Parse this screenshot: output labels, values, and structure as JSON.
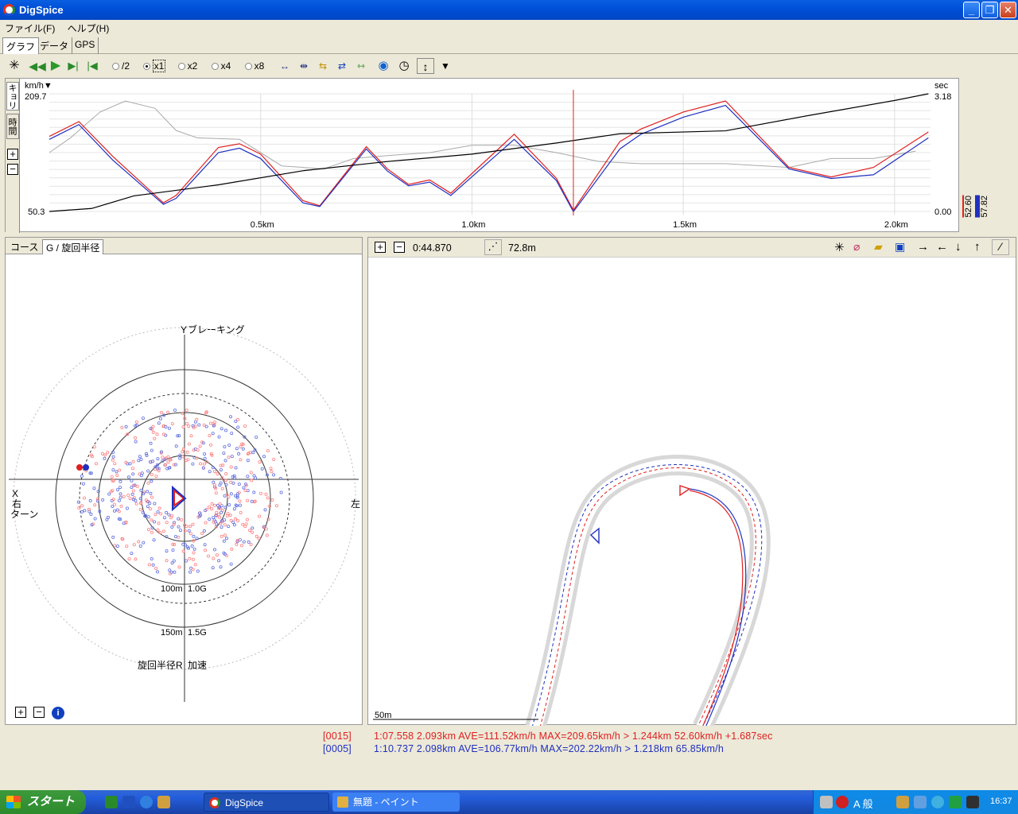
{
  "window": {
    "title": "DigSpice",
    "minimize": "_",
    "maximize": "❐",
    "close": "✕"
  },
  "menu": [
    "ファイル(F)",
    "ヘルプ(H)"
  ],
  "main_tabs": [
    "グラフ",
    "データ",
    "GPS"
  ],
  "toolbar": {
    "speeds": [
      "/2",
      "x1",
      "x2",
      "x4",
      "x8"
    ],
    "selected_speed": "x1"
  },
  "graph": {
    "vtabs": [
      "キョリ",
      "時間"
    ],
    "zoom_in": "⊞",
    "zoom_out": "⊟",
    "left_unit": "km/h▼",
    "left_max": "209.7",
    "left_min": "50.3",
    "right_unit": "sec",
    "right_max": "3.18",
    "right_min": "0.00",
    "x_ticks": [
      "0.5km",
      "1.0km",
      "1.5km",
      "2.0km"
    ],
    "side_values": [
      "52.60",
      "57.82"
    ]
  },
  "chart_data": {
    "type": "line",
    "xlabel": "",
    "ylabel": "km/h",
    "x_unit": "km",
    "ylim": [
      50.3,
      209.7
    ],
    "y2lim": [
      0.0,
      3.18
    ],
    "series": [
      {
        "color": "#e02020",
        "x": [
          0.0,
          0.07,
          0.15,
          0.27,
          0.3,
          0.4,
          0.45,
          0.5,
          0.6,
          0.64,
          0.75,
          0.8,
          0.85,
          0.9,
          0.95,
          1.1,
          1.2,
          1.24,
          1.35,
          1.4,
          1.5,
          1.6,
          1.75,
          1.85,
          1.95,
          2.08
        ],
        "y": [
          152,
          172,
          125,
          62,
          72,
          137,
          142,
          128,
          65,
          58,
          138,
          108,
          87,
          93,
          75,
          155,
          95,
          52,
          145,
          162,
          185,
          200,
          110,
          97,
          110,
          158
        ]
      },
      {
        "color": "#2030c0",
        "x": [
          0.0,
          0.07,
          0.15,
          0.27,
          0.3,
          0.4,
          0.45,
          0.5,
          0.6,
          0.64,
          0.75,
          0.8,
          0.85,
          0.9,
          0.95,
          1.1,
          1.2,
          1.24,
          1.35,
          1.4,
          1.5,
          1.6,
          1.75,
          1.85,
          1.95,
          2.08
        ],
        "y": [
          148,
          168,
          120,
          60,
          68,
          130,
          136,
          122,
          62,
          57,
          135,
          105,
          85,
          90,
          72,
          148,
          92,
          50,
          135,
          155,
          178,
          194,
          108,
          95,
          100,
          150
        ]
      },
      {
        "color": "#000000",
        "axis": "right",
        "x": [
          0.0,
          0.1,
          0.2,
          0.4,
          0.6,
          0.8,
          1.0,
          1.2,
          1.35,
          1.6,
          1.8,
          2.0,
          2.08
        ],
        "y": [
          0.0,
          0.08,
          0.42,
          0.72,
          1.1,
          1.35,
          1.55,
          1.85,
          2.1,
          2.18,
          2.6,
          3.0,
          3.18
        ]
      }
    ]
  },
  "gcircle": {
    "tabs": [
      "コース",
      "G / 旋回半径"
    ],
    "labels": {
      "y": "Y",
      "braking": "ブレーキング",
      "x": "X",
      "right": "右",
      "turn": "ターン",
      "left": "左",
      "r100": "100m",
      "g10": "1.0G",
      "r150": "150m",
      "g15": "1.5G",
      "radius": "旋回半径R",
      "accel": "加速"
    }
  },
  "map": {
    "time": "0:44.870",
    "distance": "72.8m",
    "scale": "50m"
  },
  "laps": [
    {
      "id": "[0015]",
      "text": "1:07.558  2.093km  AVE=111.52km/h  MAX=209.65km/h > 1.244km  52.60km/h  +1.687sec",
      "color": "#e02020"
    },
    {
      "id": "[0005]",
      "text": "1:10.737  2.098km  AVE=106.77km/h  MAX=202.22km/h > 1.218km  65.85km/h",
      "color": "#2030c0"
    }
  ],
  "taskbar": {
    "start": "スタート",
    "tasks": [
      "DigSpice",
      "無題 - ペイント"
    ],
    "clock": "16:37",
    "ime": "A 般"
  }
}
